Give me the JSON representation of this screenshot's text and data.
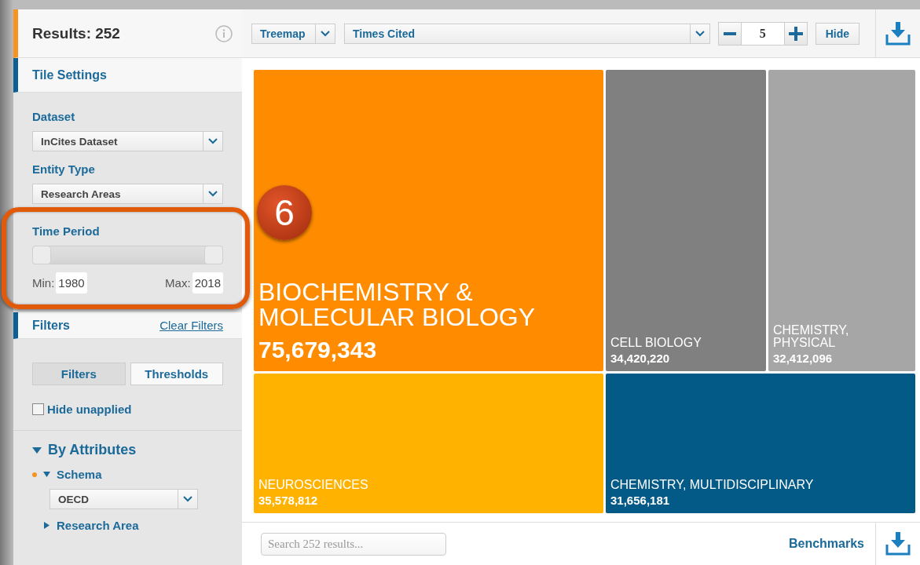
{
  "sidebar": {
    "results": "Results: 252",
    "tile_settings": {
      "title": "Tile Settings",
      "dataset": {
        "label": "Dataset",
        "value": "InCites Dataset"
      },
      "entity_type": {
        "label": "Entity Type",
        "value": "Research Areas"
      },
      "time_period": {
        "label": "Time Period",
        "min_label": "Min:",
        "min": "1980",
        "max_label": "Max:",
        "max": "2018"
      }
    },
    "filters": {
      "title": "Filters",
      "clear": "Clear Filters",
      "modes": [
        {
          "label": "Filters",
          "selected": true
        },
        {
          "label": "Thresholds",
          "selected": false
        }
      ],
      "hide_unapplied": {
        "label": "Hide unapplied",
        "checked": false
      },
      "by_attributes": {
        "label": "By Attributes",
        "expanded": true,
        "children": [
          {
            "label": "Schema",
            "expanded": true,
            "modified": true,
            "value": "OECD"
          },
          {
            "label": "Research Area",
            "expanded": false,
            "modified": false
          }
        ]
      }
    }
  },
  "toolbar": {
    "visualization": "Treemap",
    "metric": "Times Cited",
    "count": "5",
    "hide": "Hide"
  },
  "treemap": {
    "tiles": [
      {
        "name": "BIOCHEMISTRY & MOLECULAR BIOLOGY",
        "value": "75,679,343",
        "color": "#ff8c00"
      },
      {
        "name": "CELL BIOLOGY",
        "value": "34,420,220",
        "color": "#808080"
      },
      {
        "name": "CHEMISTRY, PHYSICAL",
        "value": "32,412,096",
        "color": "#a6a6a6"
      },
      {
        "name": "NEUROSCIENCES",
        "value": "35,578,812",
        "color": "#ffb300"
      },
      {
        "name": "CHEMISTRY, MULTIDISCIPLINARY",
        "value": "31,656,181",
        "color": "#035a87"
      }
    ]
  },
  "footer": {
    "search": {
      "placeholder": "Search 252 results..."
    },
    "benchmarks": "Benchmarks"
  },
  "callout": "6"
}
